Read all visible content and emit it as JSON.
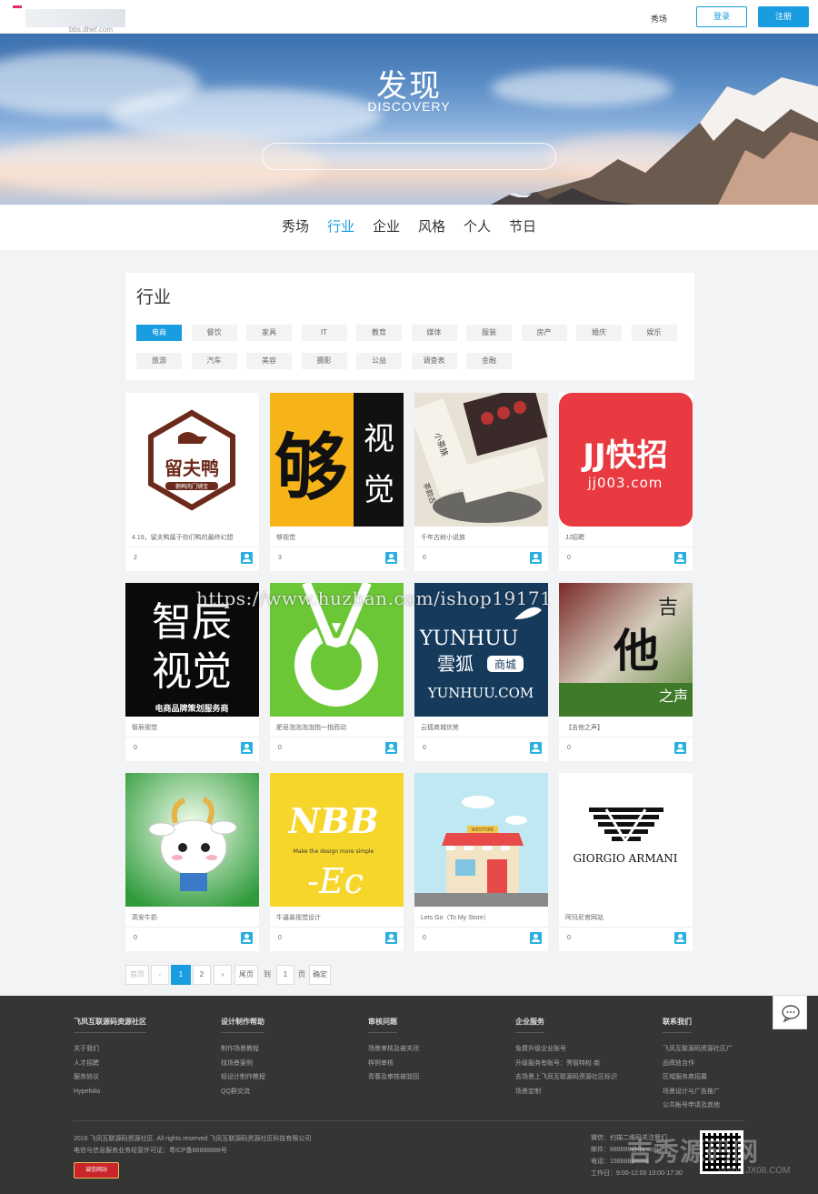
{
  "header": {
    "logo_sub": "bbs.dhef.com",
    "nav_show": "秀场",
    "login": "登录",
    "register": "注册"
  },
  "hero": {
    "title": "发现",
    "subtitle": "DISCOVERY",
    "search_placeholder": ""
  },
  "tabs": [
    "秀场",
    "行业",
    "企业",
    "风格",
    "个人",
    "节日"
  ],
  "active_tab": "行业",
  "filter": {
    "title": "行业",
    "tags": [
      "电商",
      "餐饮",
      "家具",
      "IT",
      "教育",
      "媒体",
      "服装",
      "房产",
      "婚庆",
      "娱乐",
      "旅游",
      "汽车",
      "美容",
      "摄影",
      "公益",
      "调查表",
      "金融"
    ],
    "active": "电商"
  },
  "cards": [
    {
      "title": "4.19，留夫鸭属于你们鸭的最终幻想",
      "count": "2",
      "thumb": "duck-logo"
    },
    {
      "title": "够视觉",
      "count": "3",
      "thumb": "calligraphy"
    },
    {
      "title": "千年古树小说族",
      "count": "0",
      "thumb": "tea-box"
    },
    {
      "title": "JJ招聘",
      "count": "0",
      "thumb": "jj-logo"
    },
    {
      "title": "智辰视觉",
      "count": "0",
      "thumb": "zhichen-logo"
    },
    {
      "title": "肥皂泡泡泡泡指一指而动",
      "count": "0",
      "thumb": "green-v"
    },
    {
      "title": "云狐商城优势",
      "count": "0",
      "thumb": "yunhuu-logo"
    },
    {
      "title": "【吉他之声】",
      "count": "0",
      "thumb": "guitar-grass"
    },
    {
      "title": "高安牛奶",
      "count": "0",
      "thumb": "goat-cartoon"
    },
    {
      "title": "牛逼装视觉设计",
      "count": "0",
      "thumb": "nbb-yellow"
    },
    {
      "title": "Lets Go（To My Store）",
      "count": "0",
      "thumb": "store-illustration"
    },
    {
      "title": "阿玛尼官网站",
      "count": "0",
      "thumb": "armani-logo"
    }
  ],
  "thumb_text": {
    "duck_main": "留夫鸭",
    "duck_sub": "鹅鸭肉门铺宝",
    "calli_big": "够",
    "calli_right": "视觉",
    "tea_label": "小茶族",
    "tea_label2": "茶韵古",
    "jj_main": "JJ快招",
    "jj_domain": "jj003.com",
    "zc_big1": "智辰",
    "zc_big2": "视觉",
    "zc_sub": "电商品牌策划服务商",
    "yun_big": "YUNHUU",
    "yun_cn": "雲狐",
    "yun_tag": "商城",
    "yun_domain": "YUNHUU.COM",
    "guitar_char1": "吉",
    "guitar_char2": "他",
    "guitar_char3": "之声",
    "nbb_big": "NBB",
    "nbb_tagline": "Make the design more simple",
    "nbb_ec": "-Ec",
    "store_sign": "WESTORE",
    "armani_name": "GIORGIO ARMANI"
  },
  "watermark": "https://www.huzhan.com/ishop19171",
  "pagination": {
    "first": "首页",
    "prev": "‹",
    "pages": [
      "1",
      "2"
    ],
    "current": "1",
    "next": "›",
    "last": "尾页",
    "goto": "到",
    "page_input": "1",
    "page_unit": "页",
    "confirm": "确定"
  },
  "footer": {
    "columns": [
      {
        "heading": "飞凤互联源码资源社区",
        "links": [
          "关于我们",
          "人才招聘",
          "服务协议",
          "Hypefolio"
        ]
      },
      {
        "heading": "设计制作帮助",
        "links": [
          "制作场景教程",
          "找场景案例",
          "轻设计制作教程",
          "QQ群交流"
        ]
      },
      {
        "heading": "审核问题",
        "links": [
          "场景审核及被关闭",
          "样例审核",
          "青春及审核被驳回"
        ]
      },
      {
        "heading": "企业服务",
        "links": [
          "免费升级企业账号",
          "升级服务有账号：秀智特权·新",
          "去场景上飞凤互联源码资源社区标识",
          "场景定制"
        ]
      },
      {
        "heading": "联系我们",
        "links": [
          "飞凤互联源码资源社区广",
          "品牌放合作",
          "区域服务商招募",
          "场景设计与广告推广",
          "公共帐号申请及其他"
        ]
      }
    ],
    "copyright": "2016 飞凤互联源码资源社区. All rights reserved 飞凤互联源码资源社区科技有限公司",
    "license": "电信与信息服务业务经营许可证：粤ICP备88888888号",
    "badge": "诚信网站",
    "contact": [
      "微信：扫描二维码关注我们",
      "邮件：888888@qq.com",
      "电话：15888888888",
      "工作日：9:00-12:00 13:00-17:30"
    ],
    "site_watermark": "吉秀源码网",
    "site_watermark_sub": "WWW.JX08.COM"
  }
}
